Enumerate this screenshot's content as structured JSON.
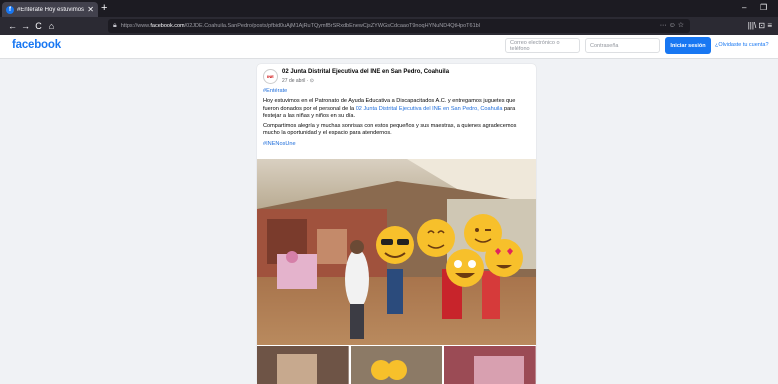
{
  "browser": {
    "tab_title": "#Entérate Hoy estuvimos en el...",
    "tab_close": "✕",
    "new_tab": "+",
    "url_prefix": "https://www.",
    "url_domain": "facebook.com",
    "url_rest": "/02JDE.Coahuila.SanPedro/posts/pfbid0uAjM1AjRuTQymfBrSRxdbEnewCjsZYWGsCdcaaoT9noqHYNuND4QtHpoT61bl",
    "nav_back": "←",
    "nav_forward": "→",
    "nav_reload": "C",
    "nav_home": "⌂",
    "url_right_icons": "··· ☺ ☆",
    "right_nav": "|||\\  ⊡  ≡",
    "win_minimize": "–",
    "win_restore": "❐"
  },
  "header": {
    "logo": "facebook",
    "email_placeholder": "Correo electrónico o teléfono",
    "password_placeholder": "Contraseña",
    "login_label": "Iniciar sesión",
    "forgot_label": "¿Olvidaste tu cuenta?"
  },
  "post": {
    "avatar_text": "INE",
    "page_name": "02 Junta Distrital Ejecutiva del INE en San Pedro, Coahuila",
    "date": "27 de abril · ⊙",
    "hashtag_top": "#Entérate",
    "para1_a": "Hoy estuvimos en el Patronato de Ayuda Educativa a Discapacitados A.C. y entregamos juguetes que fueron donados por el personal de la ",
    "para1_link": "02 Junta Distrital Ejecutiva del INE en San Pedro, Coahuila",
    "para1_b": " para festejar a las niñas y niños en su día.",
    "para2": "Compartimos alegría y muchas sonrisas con estos pequeños y sus maestras, a quienes agradecemos mucho la oportunidad y el espacio para atendernos.",
    "hashtag_bottom": "#INENosUne"
  },
  "colors": {
    "brand": "#1877f2",
    "link": "#216fdb",
    "page_bg": "#f0f2f5"
  }
}
